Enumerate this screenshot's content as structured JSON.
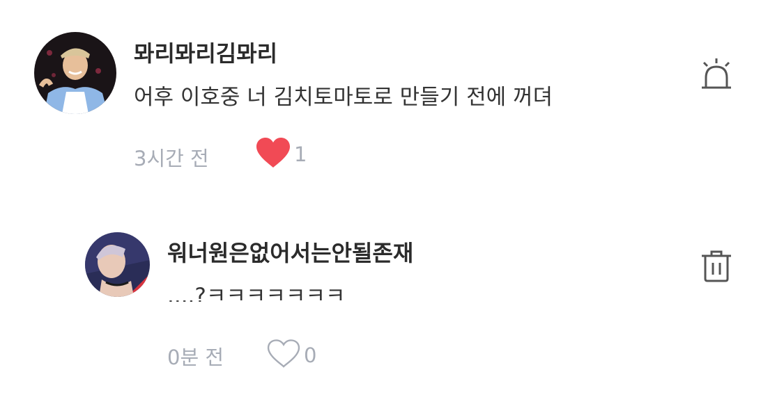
{
  "comments": [
    {
      "username": "뫄리뫄리김뫄리",
      "text": "어후 이호중 너 김치토마토로 만들기 전에 꺼뎌",
      "time": "3시간 전",
      "likes": "1",
      "liked": true,
      "action_icon": "alarm-icon"
    }
  ],
  "reply": {
    "username": "워너원은없어서는안될존재",
    "text": "....?ㅋㅋㅋㅋㅋㅋㅋ",
    "time": "0분 전",
    "likes": "0",
    "liked": false,
    "action_icon": "trash-icon"
  },
  "colors": {
    "heart_filled": "#f14a55",
    "meta_gray": "#a7acb6",
    "username": "#2b2b2b"
  }
}
